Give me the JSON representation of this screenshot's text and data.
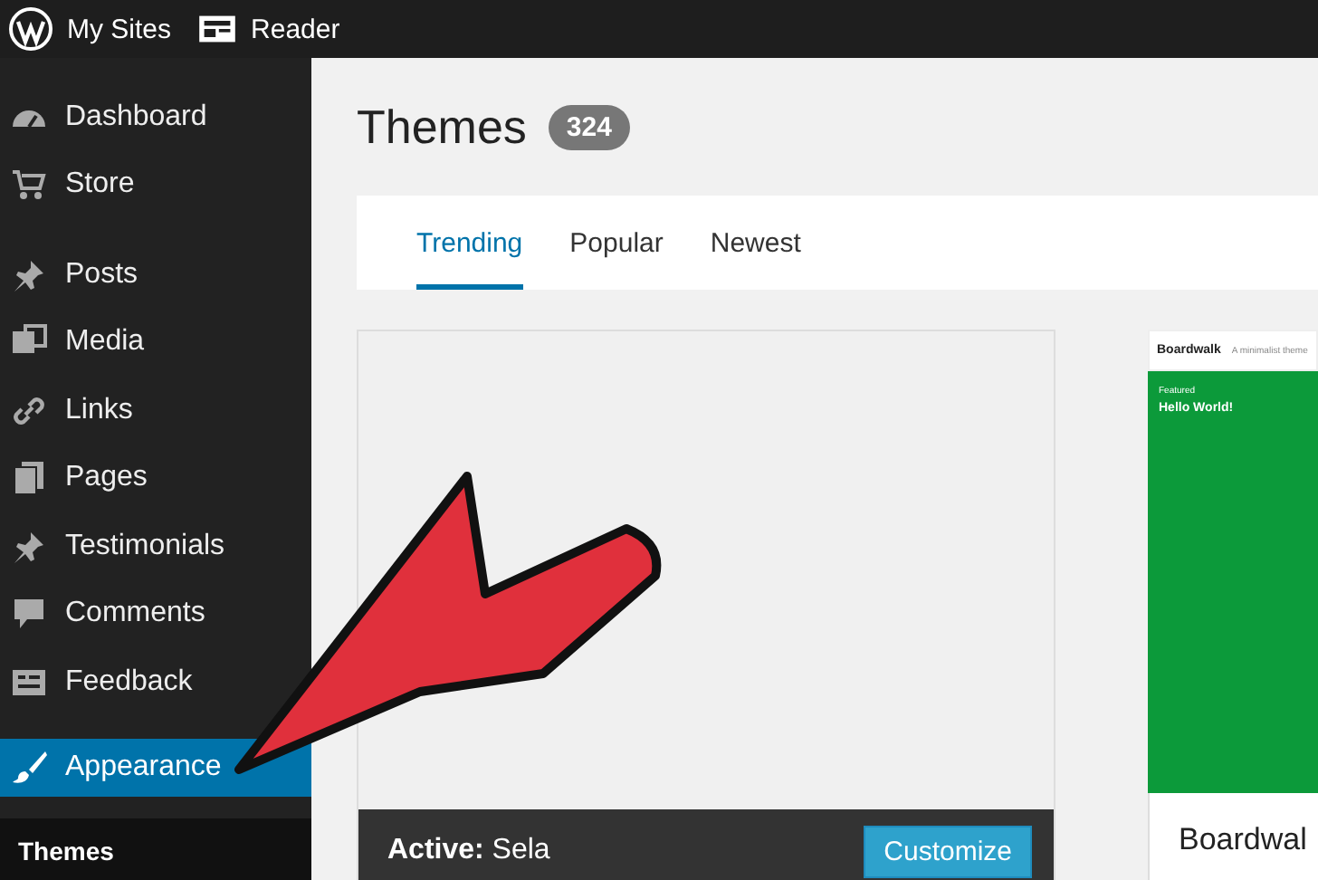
{
  "top_bar": {
    "items": [
      {
        "label": "My Sites"
      },
      {
        "label": "Reader"
      }
    ]
  },
  "sidebar": {
    "groups": [
      {
        "items": [
          {
            "label": "Dashboard",
            "selected": false
          },
          {
            "label": "Store",
            "selected": false
          }
        ]
      },
      {
        "items": [
          {
            "label": "Posts",
            "selected": false
          },
          {
            "label": "Media",
            "selected": false
          },
          {
            "label": "Links",
            "selected": false
          },
          {
            "label": "Pages",
            "selected": false
          },
          {
            "label": "Testimonials",
            "selected": false
          },
          {
            "label": "Comments",
            "selected": false
          },
          {
            "label": "Feedback",
            "selected": false
          }
        ]
      },
      {
        "items": [
          {
            "label": "Appearance",
            "selected": true
          }
        ]
      }
    ],
    "submenu": [
      {
        "label": "Themes",
        "selected": true
      }
    ]
  },
  "page": {
    "title": "Themes",
    "count": "324"
  },
  "tabs": [
    {
      "label": "Trending",
      "selected": true
    },
    {
      "label": "Popular",
      "selected": false
    },
    {
      "label": "Newest",
      "selected": false
    }
  ],
  "themes": [
    {
      "kind": "active",
      "status": "Active:",
      "name": "Sela",
      "button": "Customize"
    },
    {
      "kind": "preview",
      "name": "Boardwal",
      "preview": {
        "site_title": "Boardwalk",
        "tagline": "A minimalist theme",
        "label": "Featured",
        "heading": "Hello World!"
      }
    }
  ]
}
